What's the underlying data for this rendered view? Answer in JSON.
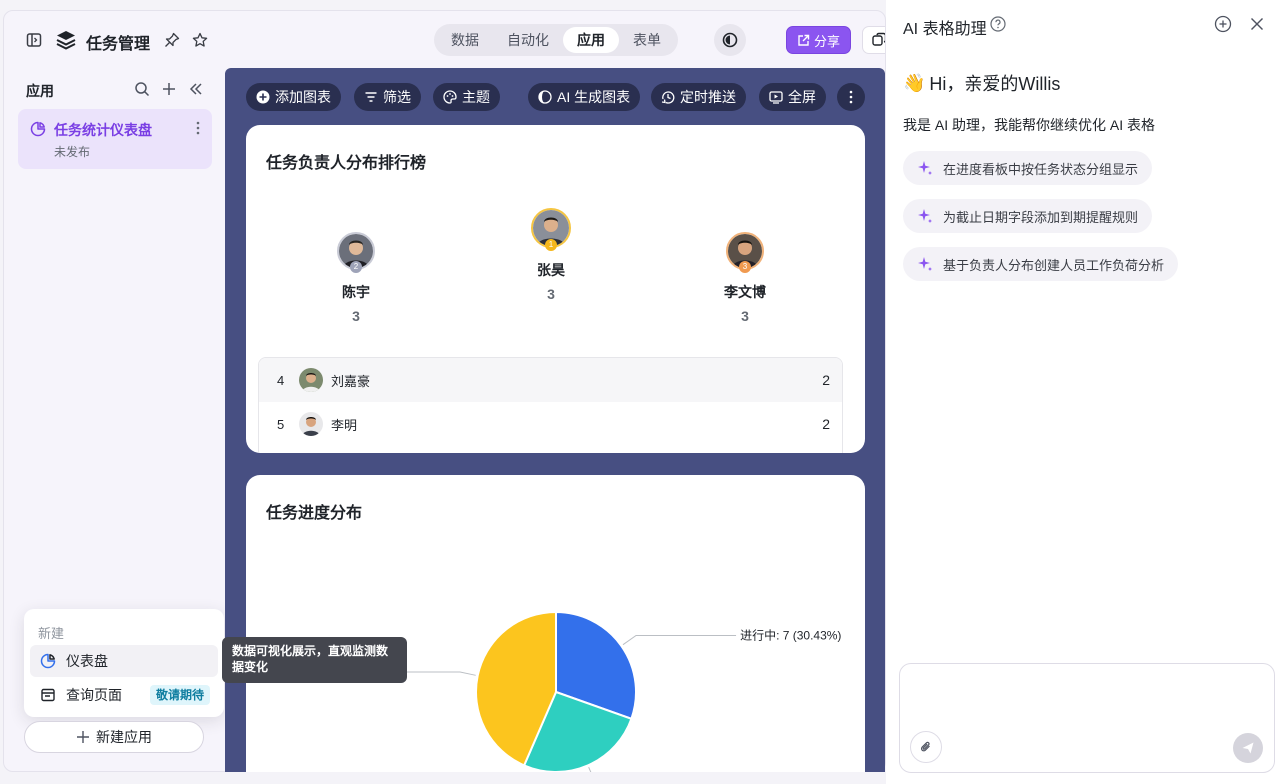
{
  "header": {
    "app_title": "任务管理",
    "view_tabs": [
      {
        "label": "数据",
        "active": false
      },
      {
        "label": "自动化",
        "active": false
      },
      {
        "label": "应用",
        "active": true
      },
      {
        "label": "表单",
        "active": false
      }
    ],
    "share_label": "分享"
  },
  "sidebar": {
    "title": "应用",
    "items": [
      {
        "label": "任务统计仪表盘",
        "status": "未发布"
      }
    ],
    "new_menu": {
      "header": "新建",
      "items": [
        {
          "label": "仪表盘",
          "icon": "dashboard-icon",
          "badge": ""
        },
        {
          "label": "查询页面",
          "icon": "query-page-icon",
          "badge": "敬请期待"
        }
      ]
    },
    "new_app_label": "新建应用",
    "tooltip": "数据可视化展示，直观监测数据变化"
  },
  "dashboard": {
    "toolbar": [
      {
        "label": "添加图表",
        "icon": "plus-circle-icon"
      },
      {
        "label": "筛选",
        "icon": "filter-icon"
      },
      {
        "label": "主题",
        "icon": "palette-icon"
      },
      {
        "label": "AI 生成图表",
        "icon": "ai-chart-icon"
      },
      {
        "label": "定时推送",
        "icon": "schedule-icon"
      },
      {
        "label": "全屏",
        "icon": "fullscreen-icon"
      }
    ],
    "leaderboard": {
      "title": "任务负责人分布排行榜",
      "podium": [
        {
          "rank": "2",
          "name": "陈宇",
          "count": "3"
        },
        {
          "rank": "1",
          "name": "张昊",
          "count": "3"
        },
        {
          "rank": "3",
          "name": "李文博",
          "count": "3"
        }
      ],
      "rows": [
        {
          "rank": "4",
          "name": "刘嘉豪",
          "count": "2"
        },
        {
          "rank": "5",
          "name": "李明",
          "count": "2"
        }
      ]
    },
    "progress": {
      "title": "任务进度分布"
    }
  },
  "chart_data": {
    "type": "pie",
    "title": "任务进度分布",
    "slices": [
      {
        "label": "进行中",
        "value": 7,
        "percent": 30.43,
        "color": "#3370eb",
        "display": "进行中: 7 (30.43%)"
      },
      {
        "label": "",
        "value": 6,
        "percent": 26.09,
        "color": "#2ecfc0",
        "display": ""
      },
      {
        "label": "",
        "value": 10,
        "percent": 43.48,
        "color": "#fcc51e",
        "display": ""
      }
    ]
  },
  "ai_panel": {
    "title": "AI 表格助理",
    "greeting": "Hi，亲爱的Willis",
    "greeting_emoji": "👋",
    "intro": "我是 AI 助理，我能帮你继续优化 AI 表格",
    "suggestions": [
      "在进度看板中按任务状态分组显示",
      "为截止日期字段添加到期提醒规则",
      "基于负责人分布创建人员工作负荷分析"
    ]
  },
  "colors": {
    "accent": "#8b55f0",
    "dashboard_bg": "#474f82",
    "toolbar_btn": "#2a2f50",
    "sidebar_active": "#ebe3fb"
  }
}
